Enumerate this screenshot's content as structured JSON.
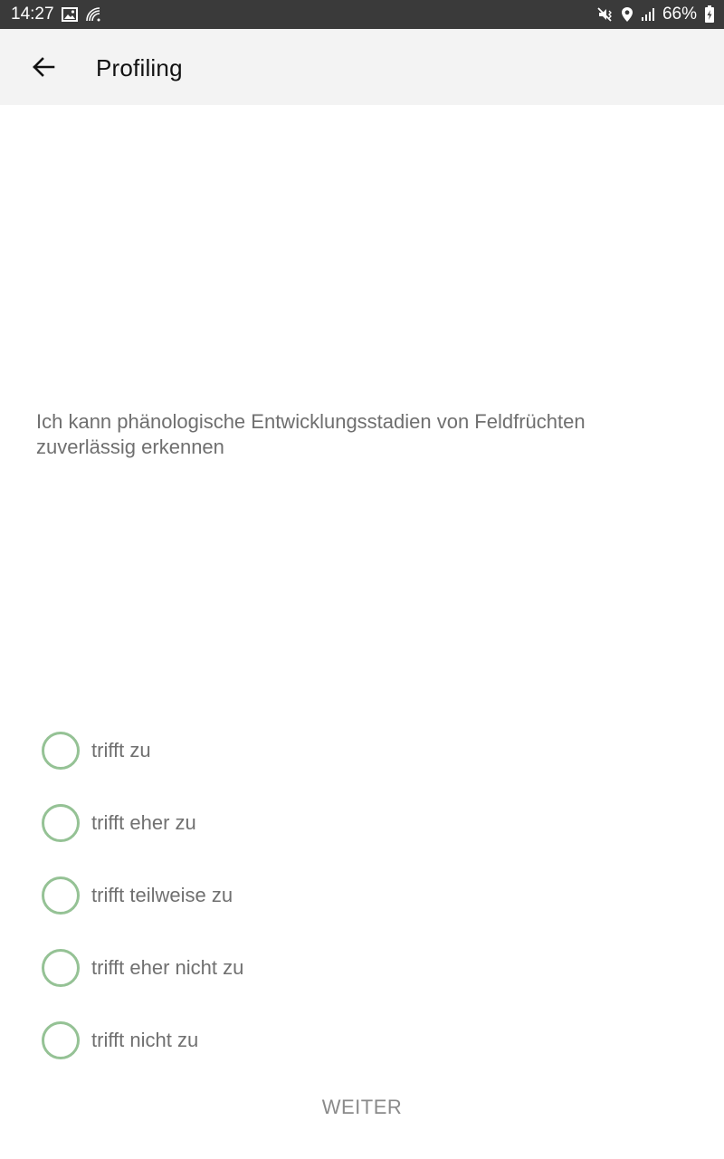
{
  "status_bar": {
    "time": "14:27",
    "battery": "66%",
    "icons": [
      "image-icon",
      "cast-icon",
      "mute-vibrate-icon",
      "location-icon",
      "signal-icon",
      "battery-icon"
    ]
  },
  "app_bar": {
    "back_icon": "arrow-left-icon",
    "title": "Profiling"
  },
  "question": {
    "text": "Ich kann phänologische Entwicklungsstadien von Feldfrüchten zuverlässig erkennen"
  },
  "options": [
    {
      "label": "trifft zu",
      "selected": false
    },
    {
      "label": "trifft eher zu",
      "selected": false
    },
    {
      "label": "trifft teilweise zu",
      "selected": false
    },
    {
      "label": "trifft eher nicht zu",
      "selected": false
    },
    {
      "label": "trifft nicht zu",
      "selected": false
    }
  ],
  "footer": {
    "next_label": "WEITER"
  },
  "colors": {
    "status_bar_bg": "#3a3a3a",
    "app_bar_bg": "#f3f3f3",
    "radio_border": "#95c295",
    "text_secondary": "#6f6f6f",
    "button_text": "#8a8a8a"
  }
}
